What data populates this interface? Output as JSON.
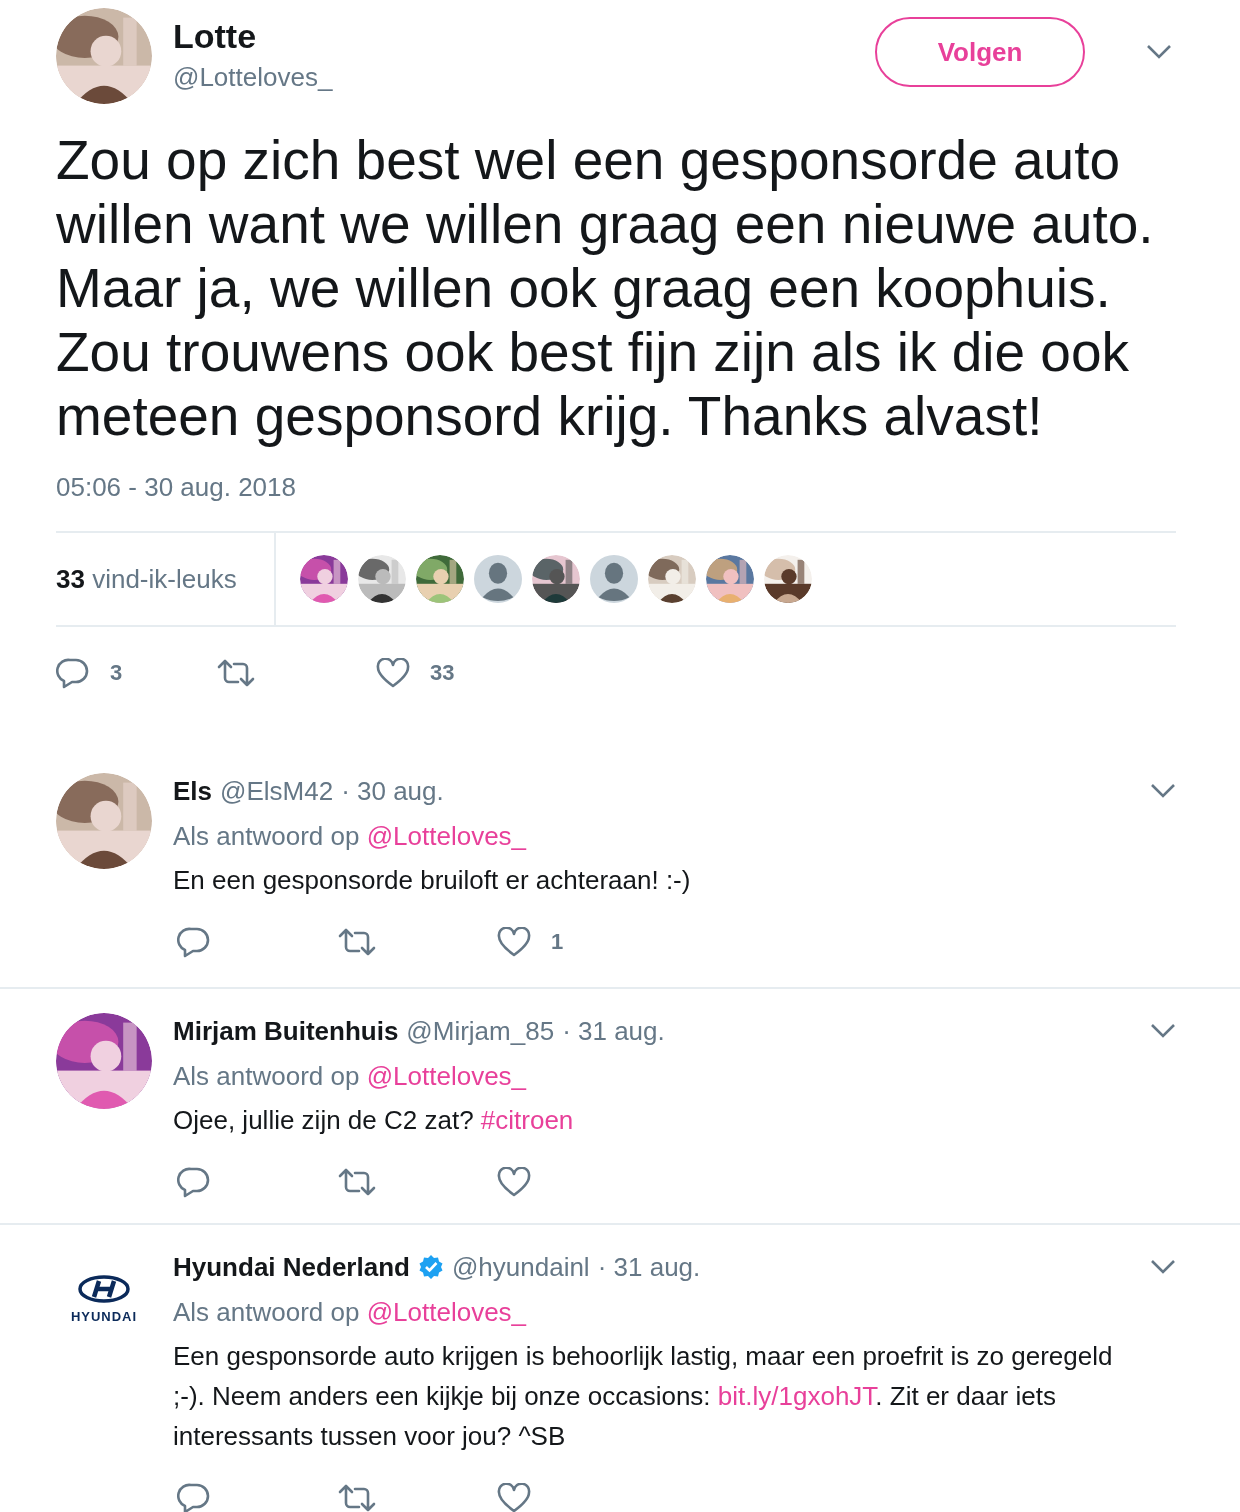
{
  "tweet": {
    "name": "Lotte",
    "handle": "@Lotteloves_",
    "avatar": {
      "kind": "picture"
    },
    "follow_label": "Volgen",
    "text": "Zou op zich best wel een gesponsorde auto willen want we willen graag een nieuwe auto. Maar ja, we willen ook graag een koophuis. Zou trouwens ook best fijn zijn als ik die ook meteen gesponsord krijg. Thanks alvast!",
    "timestamp": "05:06 - 30 aug. 2018",
    "likes_count": "33",
    "likes_label": "vind-ik-leuks",
    "likers": [
      {
        "kind": "picture"
      },
      {
        "kind": "picture"
      },
      {
        "kind": "picture"
      },
      {
        "kind": "default"
      },
      {
        "kind": "picture"
      },
      {
        "kind": "default"
      },
      {
        "kind": "picture"
      },
      {
        "kind": "picture"
      },
      {
        "kind": "picture"
      }
    ],
    "reply_count": "3",
    "like_count": "33"
  },
  "replies": [
    {
      "name": "Els",
      "verified": false,
      "handle": "@ElsM42",
      "date": "· 30 aug.",
      "avatar": {
        "kind": "picture"
      },
      "reply_to_label": "Als antwoord op",
      "reply_to": "@Lotteloves_",
      "text": [
        {
          "kind": "text",
          "text": "En een gesponsorde bruiloft er achteraan! :-)"
        }
      ],
      "like_count": "1"
    },
    {
      "name": "Mirjam Buitenhuis",
      "verified": false,
      "handle": "@Mirjam_85",
      "date": "· 31 aug.",
      "avatar": {
        "kind": "picture"
      },
      "reply_to_label": "Als antwoord op",
      "reply_to": "@Lotteloves_",
      "text": [
        {
          "kind": "text",
          "text": "Ojee, jullie zijn de C2 zat? "
        },
        {
          "kind": "link",
          "text": "#citroen"
        }
      ]
    },
    {
      "name": "Hyundai Nederland",
      "verified": true,
      "handle": "@hyundainl",
      "date": "· 31 aug.",
      "avatar": {
        "kind": "logo",
        "text": "HYUNDAI"
      },
      "reply_to_label": "Als antwoord op",
      "reply_to": "@Lotteloves_",
      "text": [
        {
          "kind": "text",
          "text": "Een gesponsorde auto krijgen is behoorlijk lastig, maar een proefrit is zo geregeld ;-). Neem anders een kijkje bij onze occasions:  "
        },
        {
          "kind": "link",
          "text": "bit.ly/1gxohJT"
        },
        {
          "kind": "text",
          "text": ". Zit er daar iets interessants tussen voor jou? ^SB"
        }
      ]
    }
  ]
}
